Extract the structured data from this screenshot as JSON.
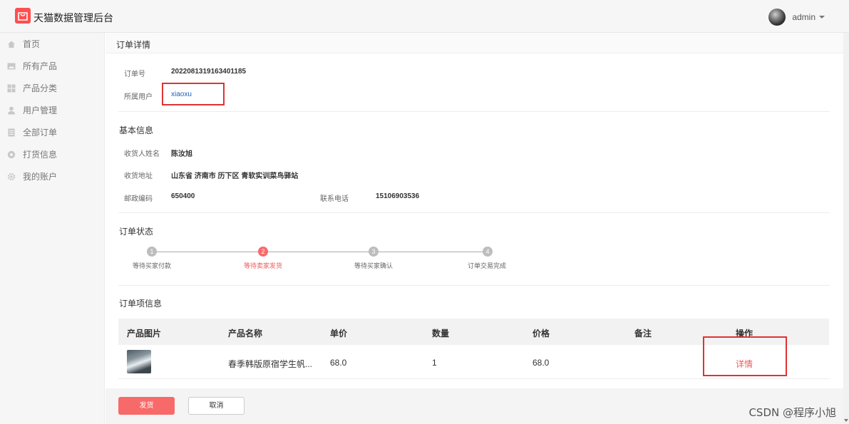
{
  "app": {
    "title": "天猫数据管理后台",
    "user": "admin"
  },
  "sidebar": {
    "items": [
      {
        "label": "首页",
        "icon": "home-icon"
      },
      {
        "label": "所有产品",
        "icon": "image-icon"
      },
      {
        "label": "产品分类",
        "icon": "grid-icon"
      },
      {
        "label": "用户管理",
        "icon": "user-icon"
      },
      {
        "label": "全部订单",
        "icon": "list-icon"
      },
      {
        "label": "打货信息",
        "icon": "dot-circle-icon"
      },
      {
        "label": "我的账户",
        "icon": "gear-icon"
      }
    ]
  },
  "panel": {
    "title": "订单详情"
  },
  "order": {
    "number_label": "订单号",
    "number": "2022081319163401185",
    "user_label": "所属用户",
    "user": "xiaoxu"
  },
  "basic": {
    "title": "基本信息",
    "name_label": "收货人姓名",
    "name": "陈汝旭",
    "address_label": "收货地址",
    "address": "山东省 济南市 历下区 青软实训菜鸟驿站",
    "zip_label": "邮政编码",
    "zip": "650400",
    "phone_label": "联系电话",
    "phone": "15106903536"
  },
  "status": {
    "title": "订单状态",
    "steps": [
      {
        "num": "1",
        "label": "等待买家付款"
      },
      {
        "num": "2",
        "label": "等待卖家发货"
      },
      {
        "num": "3",
        "label": "等待买家确认"
      },
      {
        "num": "4",
        "label": "订单交易完成"
      }
    ],
    "active_index": 1
  },
  "items": {
    "title": "订单项信息",
    "headers": [
      "产品图片",
      "产品名称",
      "单价",
      "数量",
      "价格",
      "备注",
      "操作"
    ],
    "rows": [
      {
        "name": "春季韩版原宿学生帆...",
        "price": "68.0",
        "qty": "1",
        "total": "68.0",
        "note": "",
        "action": "详情"
      }
    ]
  },
  "footer": {
    "ship_label": "发货",
    "cancel_label": "取消"
  },
  "watermark": "CSDN @程序小旭",
  "colors": {
    "accent": "#f86a6a",
    "highlight_box": "#e03232",
    "link": "#1e5fb4"
  }
}
